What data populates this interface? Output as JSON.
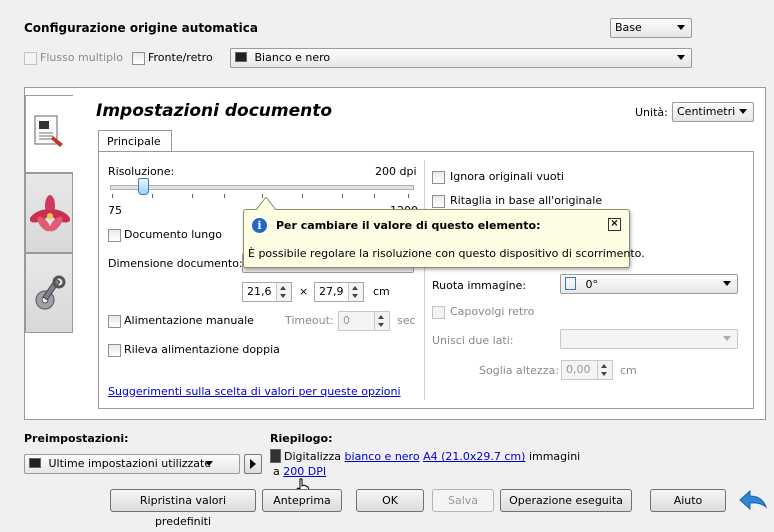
{
  "top": {
    "title": "Configurazione origine automatica",
    "profile_select": "Base",
    "flusso_multiplo": "Flusso multiplo",
    "fronte_retro": "Fronte/retro",
    "color_mode": "Bianco e nero"
  },
  "panel": {
    "title": "Impostazioni documento",
    "unit_label": "Unità:",
    "unit_value": "Centimetri",
    "tab_main": "Principale"
  },
  "left": {
    "resolution_label": "Risoluzione:",
    "resolution_value": "200 dpi",
    "slider_min": "75",
    "slider_max": "1200",
    "slider_fraction": 0.11,
    "documento_lungo": "Documento lungo",
    "dimensione_label": "Dimensione documento:",
    "width_value": "21,6",
    "times": "×",
    "height_value": "27,9",
    "unit_cm": "cm",
    "alimentazione_manuale": "Alimentazione manuale",
    "timeout_label": "Timeout:",
    "timeout_value": "0",
    "timeout_unit": "sec",
    "rileva_doppia": "Rileva alimentazione doppia",
    "suggerimenti_link": "Suggerimenti sulla scelta di valori per queste opzioni"
  },
  "right": {
    "ignora_vuoti": "Ignora originali vuoti",
    "ritaglia": "Ritaglia in base all'originale",
    "ruota_label": "Ruota immagine:",
    "ruota_value": "0°",
    "capovolgi": "Capovolgi retro",
    "unisci_label": "Unisci due lati:",
    "soglia_label": "Soglia altezza:",
    "soglia_value": "0,00",
    "soglia_unit": "cm"
  },
  "tooltip": {
    "title": "Per cambiare il valore di questo elemento:",
    "body": "È possibile regolare la risoluzione con questo dispositivo di scorrimento."
  },
  "bottom": {
    "preimpostazioni_label": "Preimpostazioni:",
    "preset_value": "Ultime impostazioni utilizzate",
    "riepilogo_label": "Riepilogo:",
    "summary_prefix": "Digitalizza",
    "summary_link1": "bianco e nero",
    "summary_link2": "A4 (21.0x29.7 cm)",
    "summary_mid": "immagini",
    "summary_a": "a",
    "summary_link3": "200 DPI"
  },
  "buttons": {
    "ripristina": "Ripristina valori predefiniti",
    "anteprima": "Anteprima",
    "ok": "OK",
    "salva": "Salva",
    "operazione": "Operazione eseguita",
    "aiuto": "Aiuto"
  },
  "colors": {
    "accent_blue": "#1f7ad1",
    "link": "#0000cc",
    "tooltip_bg": "#fdfde4"
  }
}
